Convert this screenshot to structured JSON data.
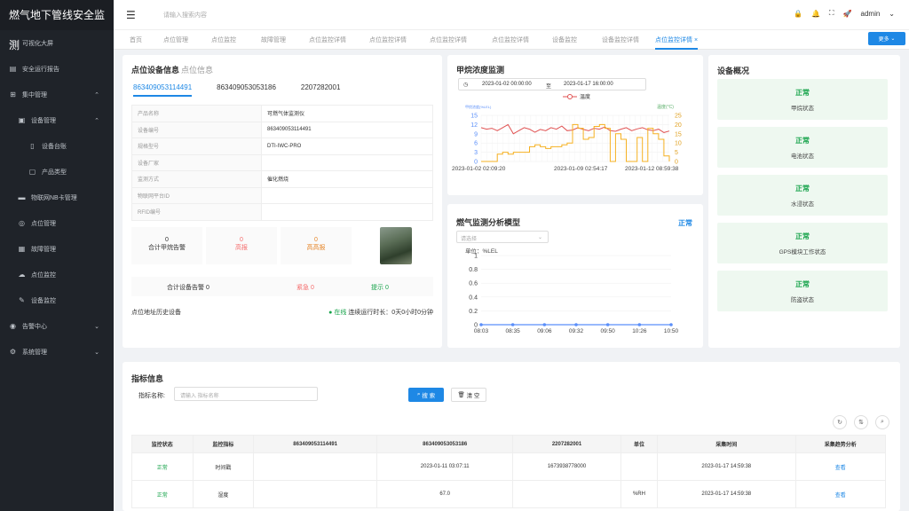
{
  "app": {
    "title": "燃气地下管线安全监测"
  },
  "sidebar": {
    "items": [
      {
        "label": "可视化大屏",
        "icon": "monitor-icon"
      },
      {
        "label": "安全运行报告",
        "icon": "report-icon"
      },
      {
        "label": "集中管理",
        "icon": "cluster-icon",
        "expanded": true
      },
      {
        "label": "设备管理",
        "icon": "device-icon",
        "expanded": true
      },
      {
        "label": "设备台账",
        "icon": "ledger-icon"
      },
      {
        "label": "产品类型",
        "icon": "product-icon"
      },
      {
        "label": "物联网NB卡管理",
        "icon": "card-icon"
      },
      {
        "label": "点位管理",
        "icon": "location-icon"
      },
      {
        "label": "故障管理",
        "icon": "fault-icon"
      },
      {
        "label": "点位监控",
        "icon": "cloud-icon"
      },
      {
        "label": "设备监控",
        "icon": "wrench-icon"
      },
      {
        "label": "告警中心",
        "icon": "alert-icon"
      },
      {
        "label": "系统管理",
        "icon": "gear-icon"
      }
    ]
  },
  "header": {
    "search_placeholder": "请输入搜索内容",
    "user": "admin"
  },
  "tabs": [
    "首页",
    "点位管理",
    "点位监控",
    "故障管理",
    "点位监控详情",
    "点位监控详情",
    "点位监控详情",
    "点位监控详情",
    "设备监控",
    "设备监控详情",
    "点位监控详情"
  ],
  "more_label": "更多",
  "device": {
    "title": "点位设备信息",
    "subtitle": "点位信息",
    "device_tabs": [
      "863409053114491",
      "863409053053186",
      "2207282001"
    ],
    "rows": [
      {
        "k": "产品名称",
        "v": "可燃气体监测仪"
      },
      {
        "k": "设备编号",
        "v": "863409053114491"
      },
      {
        "k": "规格型号",
        "v": "DTI-IWC-PRO"
      },
      {
        "k": "设备厂家",
        "v": ""
      },
      {
        "k": "监测方式",
        "v": "催化燃烧"
      },
      {
        "k": "物联网平台ID",
        "v": ""
      },
      {
        "k": "RFID编号",
        "v": ""
      }
    ],
    "stats": [
      {
        "n": "0",
        "l": "合计甲烷告警",
        "color": "#333"
      },
      {
        "n": "0",
        "l": "高报",
        "color": "#f56c6c"
      },
      {
        "n": "0",
        "l": "高高报",
        "color": "#e6862a"
      }
    ],
    "alarm": {
      "total_label": "合计设备告警 0",
      "urgent": "紧急 0",
      "tip": "提示 0"
    },
    "history_label": "点位地址历史设备",
    "online": "在线",
    "runtime": "连续运行时长：0天0小时0分钟"
  },
  "methane": {
    "title": "甲烷浓度监测",
    "range_start": "2023-01-02 00:00:00",
    "range_to": "至",
    "range_end": "2023-01-17 16:00:00",
    "legend": "温度"
  },
  "model": {
    "title": "燃气监测分析模型",
    "status": "正常",
    "select_placeholder": "请选择"
  },
  "overview": {
    "title": "设备概况",
    "items": [
      {
        "s": "正常",
        "l": "甲烷状态"
      },
      {
        "s": "正常",
        "l": "电池状态"
      },
      {
        "s": "正常",
        "l": "水浸状态"
      },
      {
        "s": "正常",
        "l": "GPS模块工作状态"
      },
      {
        "s": "正常",
        "l": "防盗状态"
      }
    ]
  },
  "indicator": {
    "title": "指标信息",
    "label": "指标名称:",
    "placeholder": "请输入 指标名称",
    "search": "搜 索",
    "reset": "清 空",
    "columns": [
      "监控状态",
      "监控指标",
      "863409053114491",
      "863409053053186",
      "2207282001",
      "单位",
      "采集时间",
      "采集趋势分析"
    ],
    "rows": [
      [
        "正常",
        "时间戳",
        "",
        "2023-01-11 03:07:11",
        "1673938778000",
        "",
        "2023-01-17 14:59:38",
        "查看"
      ],
      [
        "正常",
        "湿度",
        "",
        "67.0",
        "",
        "%RH",
        "2023-01-17 14:59:38",
        "查看"
      ]
    ]
  },
  "chart_data": [
    {
      "type": "line",
      "title": "",
      "x_ticks": [
        "2023-01-02 02:09:20",
        "2023-01-09 02:54:17",
        "2023-01-12 08:59:38"
      ],
      "y_left": {
        "label": "甲烷浓度(%LEL)",
        "ticks": [
          0,
          3,
          6,
          9,
          12,
          15
        ],
        "ylim": [
          0,
          15
        ]
      },
      "y_right": {
        "label": "温度(°C)",
        "ticks": [
          0,
          5,
          10,
          15,
          20,
          25
        ],
        "ylim": [
          0,
          25
        ]
      },
      "series": [
        {
          "name": "温度",
          "axis": "left",
          "color": "#e05252",
          "values": [
            11,
            10.5,
            10.8,
            10,
            11,
            12,
            9,
            10,
            11,
            10.5,
            9.5,
            10.4,
            10,
            11,
            10.5,
            11.5,
            10,
            10.2,
            11,
            10.4,
            10,
            10.8,
            10.5,
            11.2,
            10,
            9.8,
            10.5,
            11,
            10,
            10.6,
            11,
            10.3,
            10,
            10.5,
            9.4,
            9.9
          ]
        },
        {
          "axis": "right",
          "color": "#f5b021",
          "values": [
            0,
            0,
            0,
            4,
            5,
            4,
            5,
            5,
            5,
            8,
            9,
            8,
            7,
            8,
            8,
            9,
            10,
            20,
            18,
            12,
            13,
            19,
            20,
            18,
            0,
            15,
            12,
            0,
            0,
            13,
            0,
            18,
            15,
            12,
            3,
            0
          ]
        }
      ]
    },
    {
      "type": "line",
      "ylabel": "单位：%LEL",
      "x": [
        "08:03",
        "08:35",
        "09:06",
        "09:32",
        "09:50",
        "10:26",
        "10:50"
      ],
      "values": [
        0,
        0,
        0,
        0,
        0,
        0,
        0
      ],
      "ylim": [
        0,
        1
      ],
      "y_ticks": [
        0,
        0.2,
        0.4,
        0.6,
        0.8,
        1
      ]
    }
  ]
}
